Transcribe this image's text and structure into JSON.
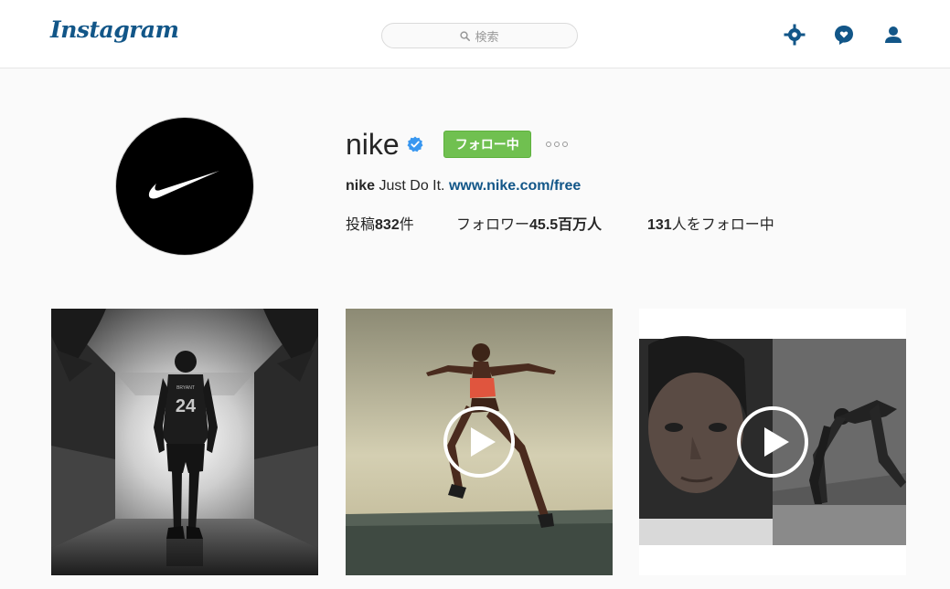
{
  "nav": {
    "logo": "Instagram",
    "search_placeholder": "検索",
    "icons": [
      "explore-icon",
      "activity-icon",
      "profile-icon"
    ],
    "brand_color": "#125688"
  },
  "profile": {
    "username": "nike",
    "verified": true,
    "follow_button_label": "フォロー中",
    "follow_button_color": "#70c050",
    "bio_name": "nike",
    "bio_text": "Just Do It.",
    "bio_link": "www.nike.com/free",
    "stats": {
      "posts_prefix": "投稿",
      "posts_count": "832",
      "posts_suffix": "件",
      "followers_prefix": "フォロワー",
      "followers_count": "45.5",
      "followers_suffix": "百万人",
      "following_count": "131",
      "following_suffix": "人をフォロー中"
    }
  },
  "grid": [
    {
      "kind": "photo",
      "jersey": "24",
      "jersey_name": "BRYANT"
    },
    {
      "kind": "video"
    },
    {
      "kind": "video"
    }
  ]
}
